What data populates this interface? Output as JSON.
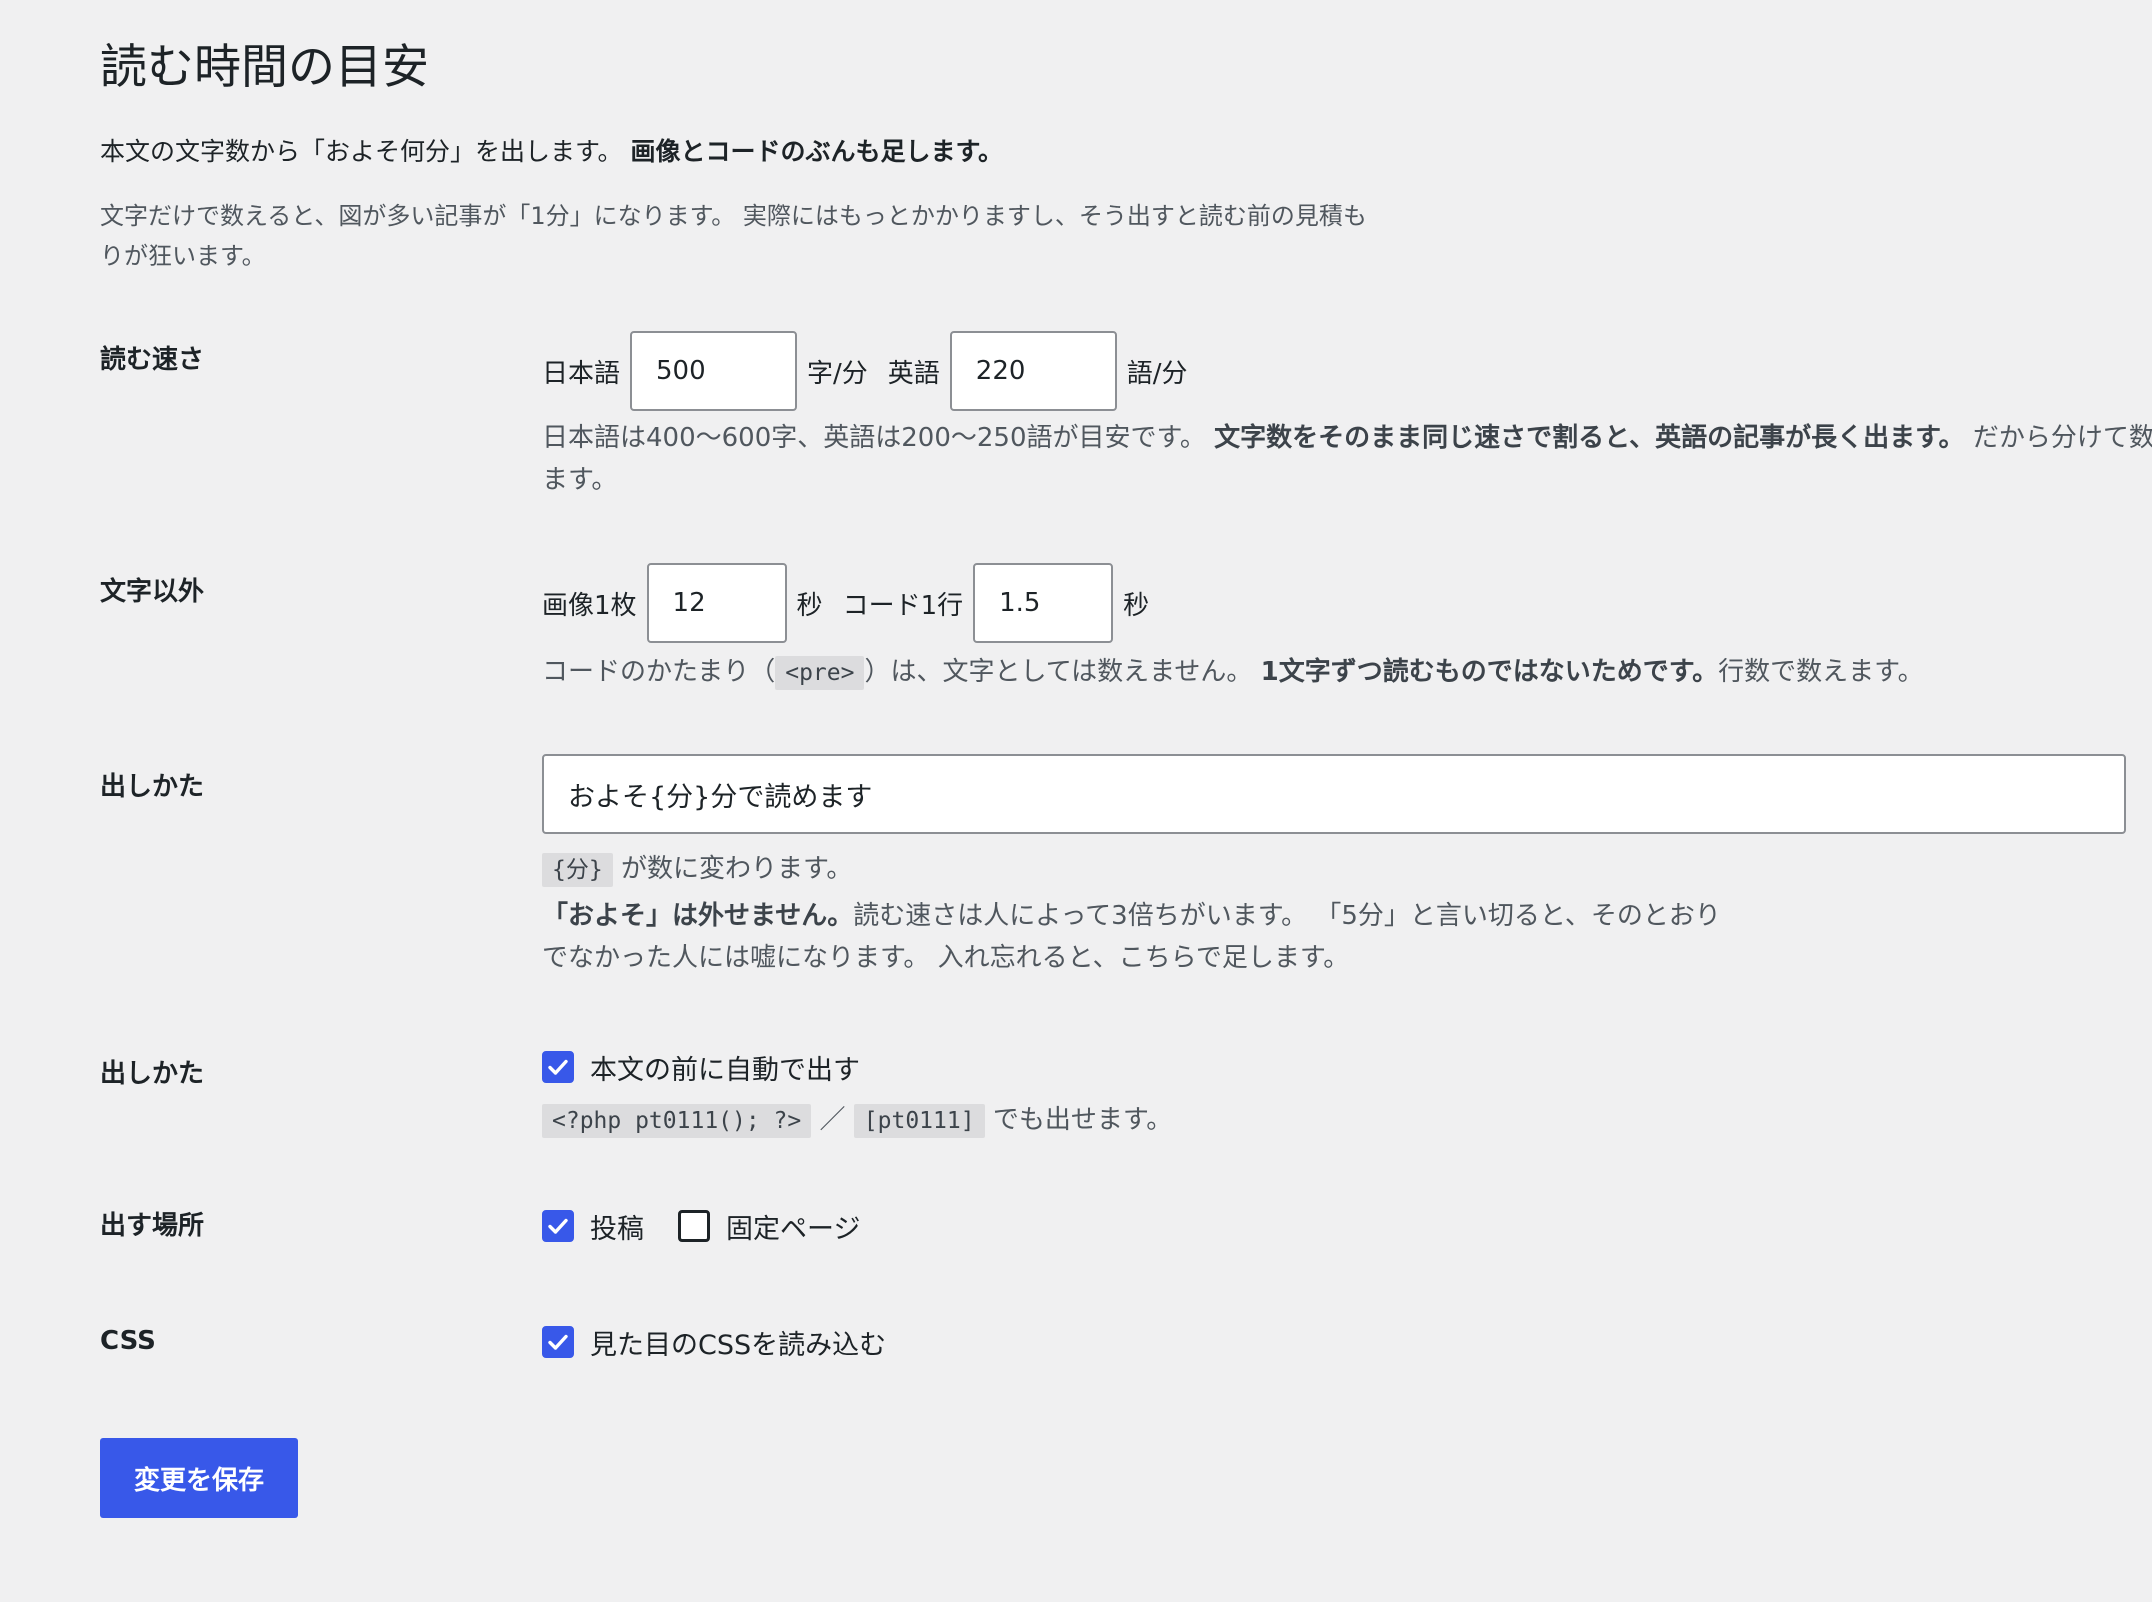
{
  "page": {
    "title": "読む時間の目安",
    "intro": "本文の文字数から「およそ何分」を出します。",
    "intro_bold": "画像とコードのぶんも足します。",
    "note": "文字だけで数えると、図が多い記事が「1分」になります。 実際にはもっとかかりますし、そう出すと読む前の見積もりが狂います。"
  },
  "speed": {
    "label": "読む速さ",
    "ja_label": "日本語",
    "ja_value": "500",
    "ja_unit": "字/分",
    "en_label": "英語",
    "en_value": "220",
    "en_unit": "語/分",
    "desc_plain": "日本語は400〜600字、英語は200〜250語が目安です。",
    "desc_bold": "文字数をそのまま同じ速さで割ると、英語の記事が長く出ます。",
    "desc_tail": "だから分けて数えています。"
  },
  "extras": {
    "label": "文字以外",
    "image_label": "画像1枚",
    "image_value": "12",
    "image_unit": "秒",
    "code_label": "コード1行",
    "code_value": "1.5",
    "code_unit": "秒",
    "desc_pre": "コードのかたまり（",
    "desc_code": "<pre>",
    "desc_mid": "）は、文字としては数えません。",
    "desc_bold": "1文字ずつ読むものではないためです。",
    "desc_tail": "行数で数えます。"
  },
  "format": {
    "label": "出しかた",
    "value": "およそ{分}分で読めます",
    "hint_code": "{分}",
    "hint_text": "が数に変わります。",
    "desc_bold": "「およそ」は外せません。",
    "desc_line1": "読む速さは人によって3倍ちがいます。 「5分」と言い切ると、そのとおり",
    "desc_line2": "でなかった人には嘘になります。 入れ忘れると、こちらで足します。"
  },
  "display": {
    "label": "出しかた",
    "auto_label": "本文の前に自動で出す",
    "auto_checked": true,
    "code_php": "<?php pt0111(); ?>",
    "separator": "／",
    "code_shortcode": "[pt0111]",
    "tail": "でも出せます。"
  },
  "placement": {
    "label": "出す場所",
    "post_label": "投稿",
    "post_checked": true,
    "page_label": "固定ページ",
    "page_checked": false
  },
  "css": {
    "label": "CSS",
    "load_label": "見た目のCSSを読み込む",
    "load_checked": true
  },
  "save_button": "変更を保存",
  "colors": {
    "accent": "#3858e9",
    "background": "#f0f0f1",
    "text": "#1d2327",
    "muted": "#50575e"
  }
}
